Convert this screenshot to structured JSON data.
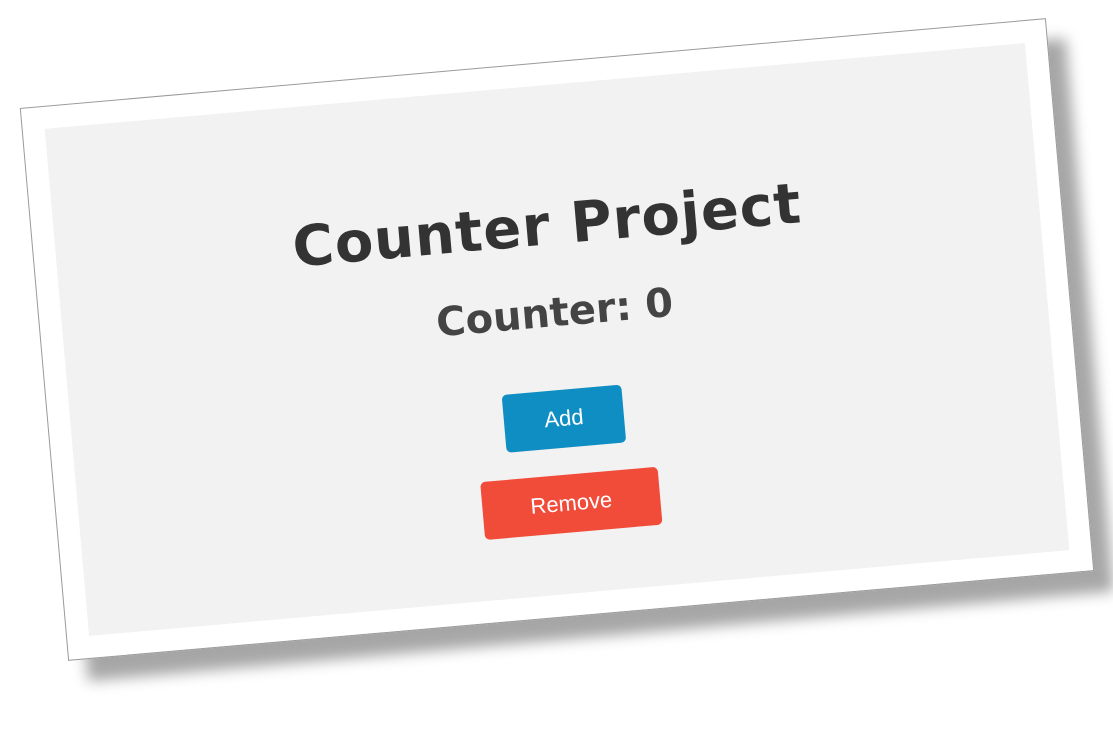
{
  "app": {
    "title": "Counter Project",
    "counter_text": "Counter: 0",
    "counter_value": 0
  },
  "buttons": {
    "add_label": "Add",
    "remove_label": "Remove"
  },
  "colors": {
    "add": "#0e8ec3",
    "remove": "#f14c39",
    "panel": "#f2f2f2",
    "text": "#333333"
  }
}
